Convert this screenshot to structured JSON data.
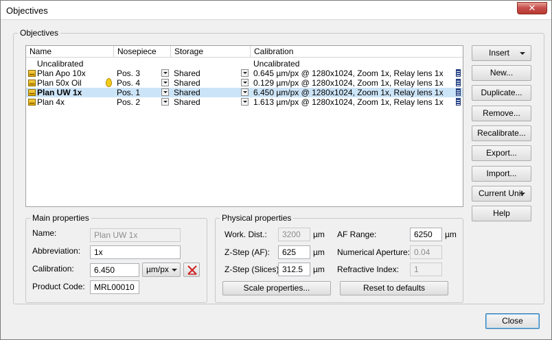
{
  "window": {
    "title": "Objectives",
    "close_symbol": "✕"
  },
  "objectives_group": {
    "label": "Objectives"
  },
  "list": {
    "columns": [
      "Name",
      "Nosepiece",
      "Storage",
      "Calibration"
    ],
    "rows": [
      {
        "name": "Uncalibrated",
        "nosepiece": "",
        "storage": "",
        "calibration": "Uncalibrated",
        "icon": "",
        "selected": false
      },
      {
        "name": "Plan Apo 10x",
        "nosepiece": "Pos. 3",
        "storage": "Shared",
        "calibration": "0.645 µm/px @ 1280x1024, Zoom 1x, Relay lens 1x",
        "icon": "objective-icon",
        "selected": false
      },
      {
        "name": "Plan 50x Oil",
        "nosepiece": "Pos. 4",
        "storage": "Shared",
        "calibration": "0.129 µm/px @ 1280x1024, Zoom 1x, Relay lens 1x",
        "icon": "objective-icon",
        "oil": true,
        "selected": false
      },
      {
        "name": "Plan UW 1x",
        "nosepiece": "Pos. 1",
        "storage": "Shared",
        "calibration": "6.450 µm/px @ 1280x1024, Zoom 1x, Relay lens 1x",
        "icon": "objective-icon",
        "selected": true
      },
      {
        "name": "Plan 4x",
        "nosepiece": "Pos. 2",
        "storage": "Shared",
        "calibration": "1.613 µm/px @ 1280x1024, Zoom 1x, Relay lens 1x",
        "icon": "objective-icon",
        "selected": false
      }
    ]
  },
  "buttons": {
    "insert": "Insert",
    "new": "New...",
    "duplicate": "Duplicate...",
    "remove": "Remove...",
    "recalibrate": "Recalibrate...",
    "export": "Export...",
    "import": "Import...",
    "current_unit": "Current Unit",
    "help": "Help",
    "close": "Close",
    "scale_properties": "Scale properties...",
    "reset_defaults": "Reset to defaults"
  },
  "main_properties": {
    "label": "Main properties",
    "name_label": "Name:",
    "name_placeholder": "Plan UW 1x",
    "abbreviation_label": "Abbreviation:",
    "abbreviation_value": "1x",
    "calibration_label": "Calibration:",
    "calibration_value": "6.450",
    "calibration_unit": "µm/px",
    "product_code_label": "Product Code:",
    "product_code_value": "MRL00010"
  },
  "physical_properties": {
    "label": "Physical properties",
    "work_dist_label": "Work. Dist.:",
    "work_dist_value": "3200",
    "work_dist_unit": "µm",
    "zstep_af_label": "Z-Step (AF):",
    "zstep_af_value": "625",
    "zstep_af_unit": "µm",
    "zstep_slices_label": "Z-Step (Slices):",
    "zstep_slices_value": "312.5",
    "zstep_slices_unit": "µm",
    "af_range_label": "AF Range:",
    "af_range_value": "6250",
    "af_range_unit": "µm",
    "na_label": "Numerical Aperture:",
    "na_value": "0.04",
    "ri_label": "Refractive Index:",
    "ri_value": "1"
  },
  "colors": {
    "selection": "#cce4f7",
    "close_button": "#c75050",
    "remove_calibration_icon": "#d02020"
  }
}
